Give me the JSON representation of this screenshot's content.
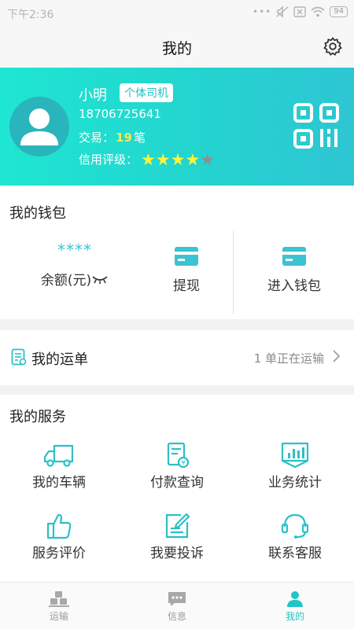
{
  "statusbar": {
    "time": "下午2:36",
    "battery": "94"
  },
  "header": {
    "title": "我的"
  },
  "profile": {
    "name": "小明",
    "badge": "个体司机",
    "phone": "18706725641",
    "trade_prefix": "交易：",
    "trade_count": "19",
    "trade_unit": "笔",
    "credit_label": "信用评级：",
    "rating": 4,
    "rating_max": 5
  },
  "wallet": {
    "title": "我的钱包",
    "balance_masked": "****",
    "balance_label": "余额(元)",
    "withdraw_label": "提现",
    "enter_label": "进入钱包"
  },
  "waybill": {
    "title": "我的运单",
    "status": "1 单正在运输"
  },
  "services": {
    "title": "我的服务",
    "items": [
      {
        "label": "我的车辆",
        "icon": "truck-icon"
      },
      {
        "label": "付款查询",
        "icon": "payment-receipt-icon"
      },
      {
        "label": "业务统计",
        "icon": "statistics-board-icon"
      },
      {
        "label": "服务评价",
        "icon": "thumbs-up-icon"
      },
      {
        "label": "我要投诉",
        "icon": "complaint-edit-icon"
      },
      {
        "label": "联系客服",
        "icon": "headset-icon"
      }
    ]
  },
  "tabbar": {
    "items": [
      {
        "label": "运输",
        "icon": "transport-boxes-icon"
      },
      {
        "label": "信息",
        "icon": "message-icon"
      },
      {
        "label": "我的",
        "icon": "user-icon"
      }
    ],
    "active": "我的"
  },
  "colors": {
    "accent": "#1fc6c8",
    "gradient_start": "#1fe6d2",
    "gradient_end": "#2ec6d3",
    "trade_count": "#ffe94a",
    "star_on": "#fff43a",
    "star_off": "#8d8f91"
  }
}
